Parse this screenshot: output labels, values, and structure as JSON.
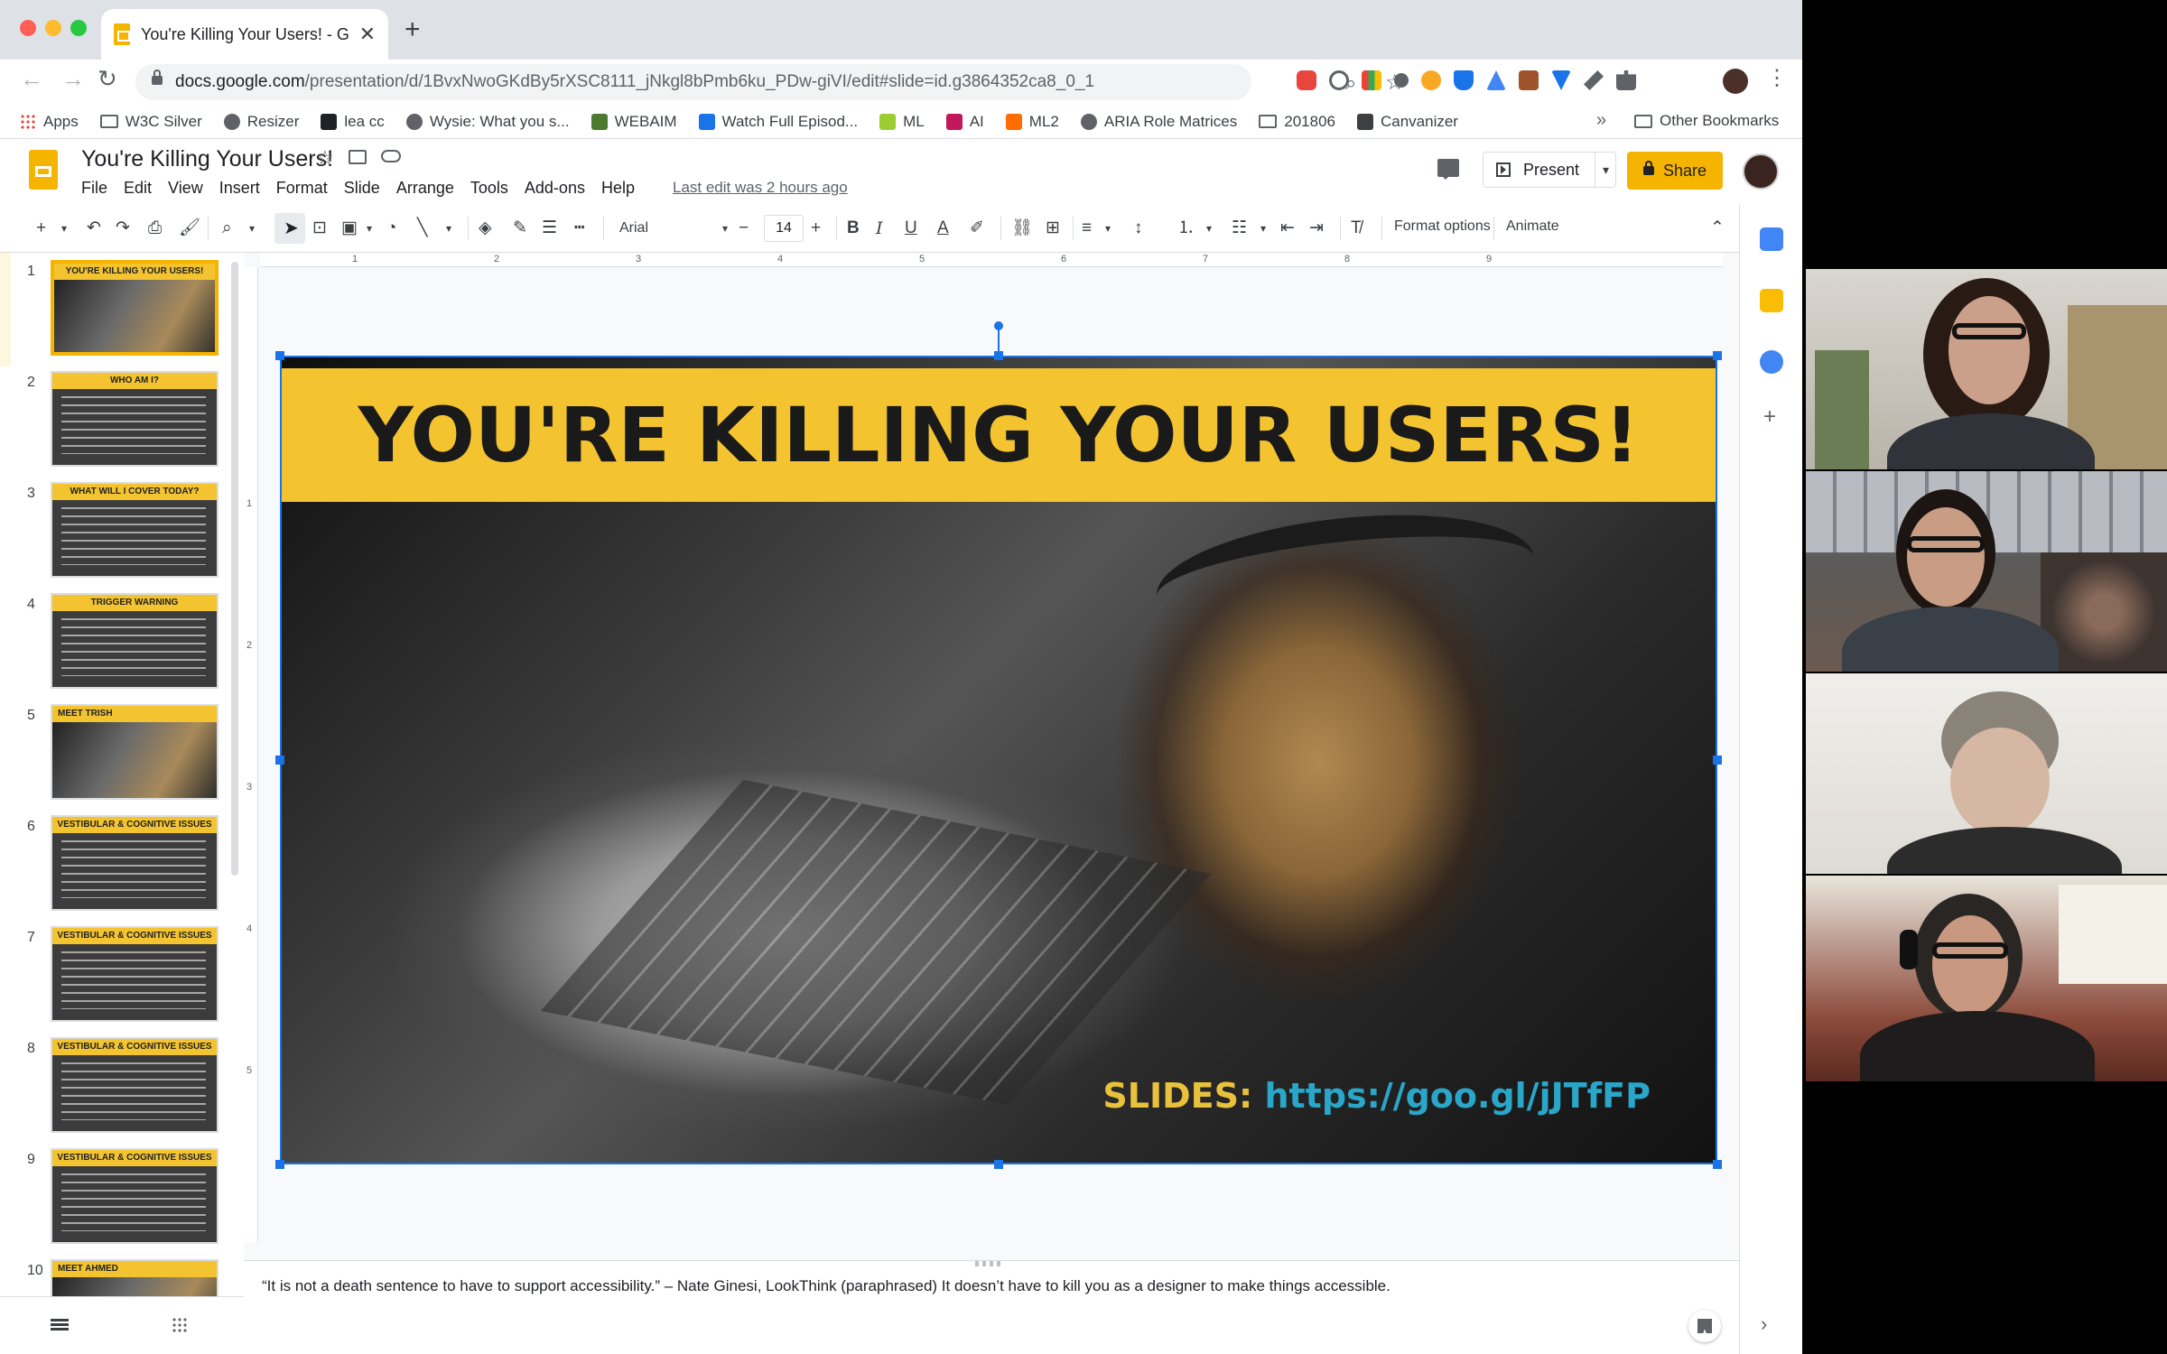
{
  "browser": {
    "tab_title": "You're Killing Your Users! - Go",
    "url_host": "docs.google.com",
    "url_path": "/presentation/d/1BvxNwoGKdBy5rXSC8111_jNkgl8bPmb6ku_PDw-giVI/edit#slide=id.g3864352ca8_0_1"
  },
  "bookmarks": {
    "items": [
      {
        "label": "Apps",
        "icon": "apps-grid-icon",
        "color": "#ea4335"
      },
      {
        "label": "W3C Silver",
        "icon": "folder-icon",
        "color": "#5f6368"
      },
      {
        "label": "Resizer",
        "icon": "globe-icon",
        "color": "#5f6368"
      },
      {
        "label": "lea cc",
        "icon": "page-icon",
        "color": "#202124"
      },
      {
        "label": "Wysie: What you s...",
        "icon": "globe-icon",
        "color": "#5f6368"
      },
      {
        "label": "WEBAIM",
        "icon": "webaim-icon",
        "color": "#4c7a2e"
      },
      {
        "label": "Watch Full Episod...",
        "icon": "tv-icon",
        "color": "#1a73e8"
      },
      {
        "label": "ML",
        "icon": "smiley-icon",
        "color": "#9acd32"
      },
      {
        "label": "AI",
        "icon": "ai-icon",
        "color": "#c2185b"
      },
      {
        "label": "ML2",
        "icon": "sparkle-icon",
        "color": "#ff6d00"
      },
      {
        "label": "ARIA Role Matrices",
        "icon": "globe-icon",
        "color": "#5f6368"
      },
      {
        "label": "201806",
        "icon": "folder-icon",
        "color": "#5f6368"
      },
      {
        "label": "Canvanizer",
        "icon": "c-icon",
        "color": "#3c4043"
      }
    ],
    "overflow": "»",
    "other": "Other Bookmarks"
  },
  "app": {
    "doc_title": "You're Killing Your Users!",
    "menus": [
      "File",
      "Edit",
      "View",
      "Insert",
      "Format",
      "Slide",
      "Arrange",
      "Tools",
      "Add-ons",
      "Help"
    ],
    "last_edit": "Last edit was 2 hours ago",
    "present_label": "Present",
    "share_label": "Share"
  },
  "format_toolbar": {
    "font": "Arial",
    "font_size": "14",
    "format_options": "Format options",
    "animate": "Animate"
  },
  "rulers": {
    "h": [
      "1",
      "2",
      "3",
      "4",
      "5",
      "6",
      "7",
      "8",
      "9"
    ],
    "v": [
      "1",
      "2",
      "3",
      "4",
      "5"
    ]
  },
  "slides": [
    {
      "num": "1",
      "title": "YOU'RE KILLING YOUR USERS!",
      "kind": "photo"
    },
    {
      "num": "2",
      "title": "WHO AM I?",
      "kind": "text"
    },
    {
      "num": "3",
      "title": "WHAT WILL I COVER TODAY?",
      "kind": "text"
    },
    {
      "num": "4",
      "title": "TRIGGER WARNING",
      "kind": "text"
    },
    {
      "num": "5",
      "title": "MEET TRISH",
      "kind": "photo"
    },
    {
      "num": "6",
      "title": "VESTIBULAR & COGNITIVE ISSUES",
      "kind": "text"
    },
    {
      "num": "7",
      "title": "VESTIBULAR & COGNITIVE ISSUES",
      "kind": "text"
    },
    {
      "num": "8",
      "title": "VESTIBULAR & COGNITIVE ISSUES",
      "kind": "text"
    },
    {
      "num": "9",
      "title": "VESTIBULAR & COGNITIVE ISSUES",
      "kind": "text"
    },
    {
      "num": "10",
      "title": "MEET AHMED",
      "kind": "photo"
    }
  ],
  "main_slide": {
    "title": "YOU'RE KILLING YOUR USERS!",
    "slides_label": "SLIDES:",
    "slides_url": "https://goo.gl/jJTfFP",
    "banner_color": "#f4c430"
  },
  "speaker_notes": "“It is not a death sentence to have to support accessibility.” – Nate Ginesi, LookThink (paraphrased) It doesn’t have to kill you as a designer to make things accessible.",
  "colors": {
    "accent": "#f4b400",
    "selection": "#1a73e8"
  }
}
